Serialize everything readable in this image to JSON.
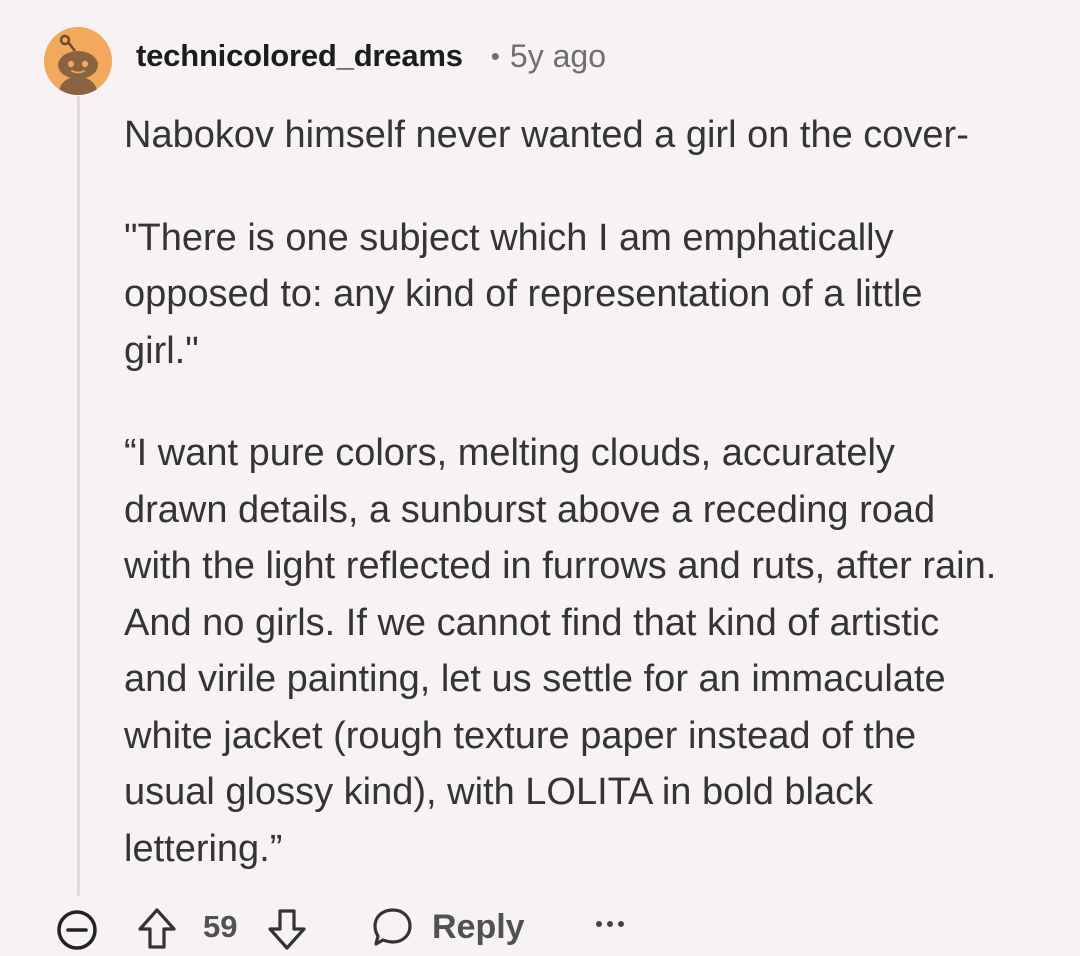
{
  "comment": {
    "avatar_icon": "reddit-snoo-avatar-icon",
    "avatar_bg": "#f2a95e",
    "username": "technicolored_dreams",
    "separator": "•",
    "time": "5y ago",
    "paragraphs": [
      "Nabokov himself never wanted a girl on the cover-",
      "\"There is one subject which I am emphatically opposed to: any kind of representation of a little girl.\"",
      "“I want pure colors, melting clouds, accurately drawn details, a sunburst above a receding road with the light reflected in furrows and ruts, after rain. And no girls. If we cannot find that kind of artistic and virile painting, let us settle for an immaculate white jacket (rough texture paper instead of the usual glossy kind), with LOLITA in bold black lettering.”"
    ]
  },
  "actions": {
    "collapse_icon": "collapse-minus-icon",
    "upvote_icon": "upvote-arrow-icon",
    "vote_count": "59",
    "downvote_icon": "downvote-arrow-icon",
    "reply_icon": "speech-bubble-icon",
    "reply_label": "Reply",
    "more_icon": "more-dots-icon"
  }
}
